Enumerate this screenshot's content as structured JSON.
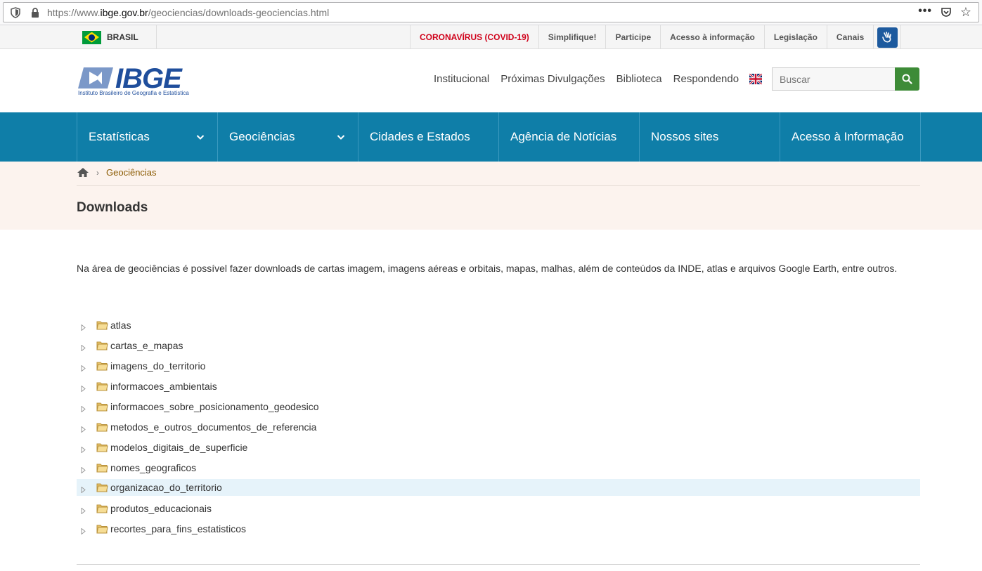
{
  "browser": {
    "url_prefix": "https://www.",
    "url_domain": "ibge.gov.br",
    "url_path": "/geociencias/downloads-geociencias.html",
    "menu": "•••"
  },
  "topbar": {
    "country": "BRASIL",
    "links": [
      {
        "label": "CORONAVÍRUS (COVID-19)"
      },
      {
        "label": "Simplifique!"
      },
      {
        "label": "Participe"
      },
      {
        "label": "Acesso à informação"
      },
      {
        "label": "Legislação"
      },
      {
        "label": "Canais"
      }
    ]
  },
  "header": {
    "logo_text": "IBGE",
    "logo_subtitle": "Instituto Brasileiro de Geografia e Estatística",
    "nav": [
      "Institucional",
      "Próximas Divulgações",
      "Biblioteca",
      "Respondendo"
    ],
    "search_placeholder": "Buscar"
  },
  "mainnav": {
    "items": [
      {
        "label": "Estatísticas",
        "dropdown": true
      },
      {
        "label": "Geociências",
        "dropdown": true
      },
      {
        "label": "Cidades e Estados",
        "dropdown": false
      },
      {
        "label": "Agência de Notícias",
        "dropdown": false
      },
      {
        "label": "Nossos sites",
        "dropdown": false
      },
      {
        "label": "Acesso à Informação",
        "dropdown": false
      }
    ]
  },
  "breadcrumb": {
    "current": "Geociências"
  },
  "page": {
    "title": "Downloads",
    "intro": "Na área de geociências é possível fazer downloads de cartas imagem, imagens aéreas e orbitais, mapas, malhas, além de conteúdos da INDE, atlas e arquivos Google Earth, entre outros."
  },
  "tree": {
    "highlighted_index": 8,
    "items": [
      "atlas",
      "cartas_e_mapas",
      "imagens_do_territorio",
      "informacoes_ambientais",
      "informacoes_sobre_posicionamento_geodesico",
      "metodos_e_outros_documentos_de_referencia",
      "modelos_digitais_de_superficie",
      "nomes_geograficos",
      "organizacao_do_territorio",
      "produtos_educacionais",
      "recortes_para_fins_estatisticos"
    ]
  },
  "colors": {
    "nav_blue": "#0f7ea8",
    "covid_red": "#d0021b",
    "search_green": "#3d8b37",
    "band_bg": "#fcf3ee",
    "highlight_row": "#e6f3fa"
  }
}
